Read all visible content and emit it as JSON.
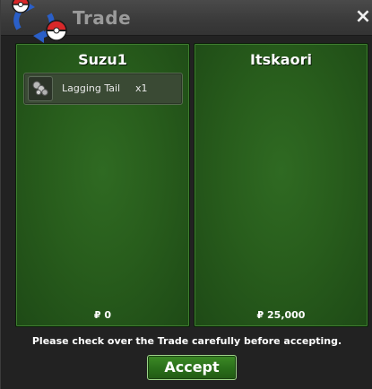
{
  "window": {
    "title": "Trade",
    "close_label": "×"
  },
  "icons": {
    "logo": "pokeball-swap-icon",
    "item": "lagging-tail-item-icon",
    "currency": "pokedollar-icon"
  },
  "left_panel": {
    "player_name": "Suzu1",
    "items": [
      {
        "name": "Lagging Tail",
        "quantity": "x1"
      }
    ],
    "money": "₽ 0"
  },
  "right_panel": {
    "player_name": "Itskaori",
    "items": [],
    "money": "₽ 25,000"
  },
  "notice": "Please check over the Trade carefully before accepting.",
  "accept_label": "Accept",
  "colors": {
    "panel_green": "#285d1c",
    "accept_green": "#2a6f1a",
    "title_gray": "#9a9a9a"
  }
}
